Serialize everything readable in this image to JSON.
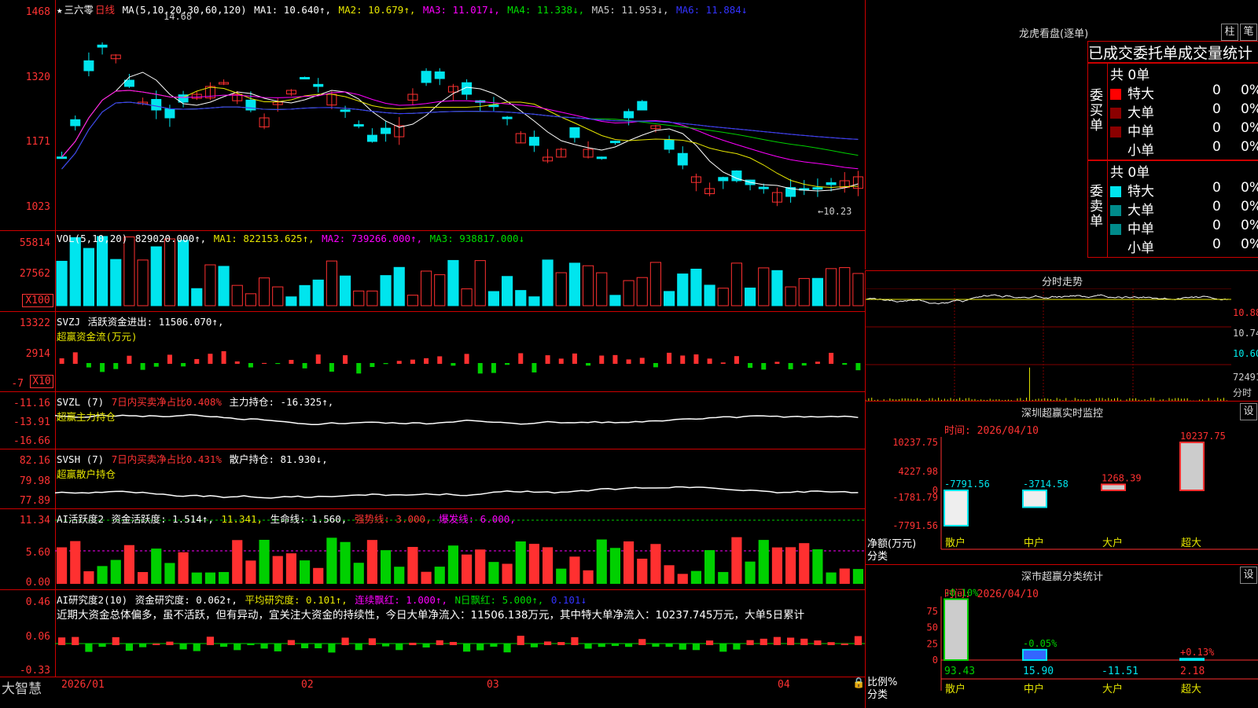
{
  "colors": {
    "up": "#ff3030",
    "down": "#00e5ee",
    "green": "#00d000",
    "magenta": "#ff00ff",
    "yellow": "#e6e600",
    "axis": "#ff3030",
    "grid": "#800000"
  },
  "kline": {
    "header": {
      "star": "★",
      "stock": "三六零",
      "period": "日线",
      "ma_label": "MA(5,10,20,30,60,120)",
      "ma1": "MA1: 10.640↑,",
      "ma2": "MA2: 10.679↑,",
      "ma3": "MA3: 11.017↓,",
      "ma4": "MA4: 11.338↓,",
      "ma5": "MA5: 11.953↓,",
      "ma6": "MA6: 11.884↓"
    },
    "yticks": [
      "1468",
      "1320",
      "1171",
      "1023"
    ],
    "high_label": "14.68",
    "low_label": "←10.23"
  },
  "vol": {
    "header": {
      "name": "VOL(5,10,20)",
      "val": "829020.000↑,",
      "ma1": "MA1: 822153.625↑,",
      "ma2": "MA2: 739266.000↑,",
      "ma3": "MA3: 938817.000↓"
    },
    "yticks": [
      "55814",
      "27562"
    ],
    "unit": "X100"
  },
  "svzj": {
    "header": {
      "name": "SVZJ",
      "t1": "活跃资金进出: 11506.070↑,",
      "t2": "超赢资金流(万元)"
    },
    "yticks": [
      "13322",
      "2914",
      "-7"
    ],
    "unit": "X10"
  },
  "svzl": {
    "header": {
      "name": "SVZL (7)",
      "t1": "7日内买卖净占比0.408%",
      "t2": "主力持仓: -16.325↑,",
      "t3": "超赢主力持仓"
    },
    "yticks": [
      "-11.16",
      "-13.91",
      "-16.66"
    ]
  },
  "svsh": {
    "header": {
      "name": "SVSH (7)",
      "t1": "7日内买卖净占比0.431%",
      "t2": "散户持仓: 81.930↓,",
      "t3": "超赢散户持仓"
    },
    "yticks": [
      "82.16",
      "79.98",
      "77.89"
    ]
  },
  "ai1": {
    "header": {
      "name": "AI活跃度2",
      "t1": "资金活跃度: 1.514↑,",
      "t2": "11.341,",
      "t3": "生命线: 1.560,",
      "t4": "强势线: 3.000,",
      "t5": "爆发线: 6.000,"
    },
    "yticks": [
      "11.34",
      "5.60",
      "0.00"
    ]
  },
  "ai2": {
    "header": {
      "name": "AI研究度2(10)",
      "t1": "资金研究度: 0.062↑,",
      "t2": "平均研究度: 0.101↑,",
      "t3": "连续飘红: 1.000↑,",
      "t4": "N日飘红: 5.000↑,",
      "t5": "0.101↓"
    },
    "text": "近期大资金总体偏多，虽不活跃，但有异动，宜关注大资金的持续性，今日大单净流入：11506.138万元，其中特大单净流入：10237.745万元，大单5日累计",
    "yticks": [
      "0.46",
      "0.06",
      "-0.33"
    ]
  },
  "xaxis": {
    "brand": "大智慧",
    "labels": [
      "2026/01",
      "02",
      "03",
      "04"
    ]
  },
  "right": {
    "lhb": {
      "title": "龙虎看盘(逐单)",
      "btn1": "柱",
      "btn2": "笔",
      "tab": "已成交委托单成交量统计",
      "buy": {
        "side": "委买单",
        "total": "共 0单",
        "rows": [
          {
            "name": "特大",
            "v": "0",
            "p": "0%"
          },
          {
            "name": "大单",
            "v": "0",
            "p": "0%"
          },
          {
            "name": "中单",
            "v": "0",
            "p": "0%"
          },
          {
            "name": "小单",
            "v": "0",
            "p": "0%"
          }
        ]
      },
      "sell": {
        "side": "委卖单",
        "total": "共 0单",
        "rows": [
          {
            "name": "特大",
            "v": "0",
            "p": "0%"
          },
          {
            "name": "大单",
            "v": "0",
            "p": "0%"
          },
          {
            "name": "中单",
            "v": "0",
            "p": "0%"
          },
          {
            "name": "小单",
            "v": "0",
            "p": "0%"
          }
        ]
      }
    },
    "fenshi": {
      "title": "分时走势",
      "yticks": [
        "10.88",
        "10.74",
        "10.60",
        "72491"
      ],
      "unit": "分时"
    },
    "monitor": {
      "title": "深圳超赢实时监控",
      "btn": "设",
      "time": "时间: 2026/04/10",
      "yticks": [
        "10237.75",
        "4227.98",
        "0",
        "-1781.79",
        "-7791.56"
      ],
      "ylabel": "净额(万元)",
      "xlabel": "分类",
      "cats": [
        "散户",
        "中户",
        "大户",
        "超大"
      ],
      "values": [
        -7791.56,
        -3714.58,
        1268.39,
        10237.75
      ],
      "labels": [
        "-7791.56",
        "-3714.58",
        "1268.39",
        "10237.75"
      ]
    },
    "classify": {
      "title": "深市超赢分类统计",
      "btn": "设",
      "time": "时间: 2026/04/10",
      "yticks": [
        "75",
        "50",
        "25",
        "0"
      ],
      "ylabel": "比例%",
      "xlabel": "分类",
      "cats": [
        "散户",
        "中户",
        "大户",
        "超大"
      ],
      "values": [
        93.43,
        15.9,
        -11.51,
        2.18
      ],
      "changes": [
        "-0.10%",
        "-0.05%",
        "",
        "+0.13%"
      ]
    }
  }
}
